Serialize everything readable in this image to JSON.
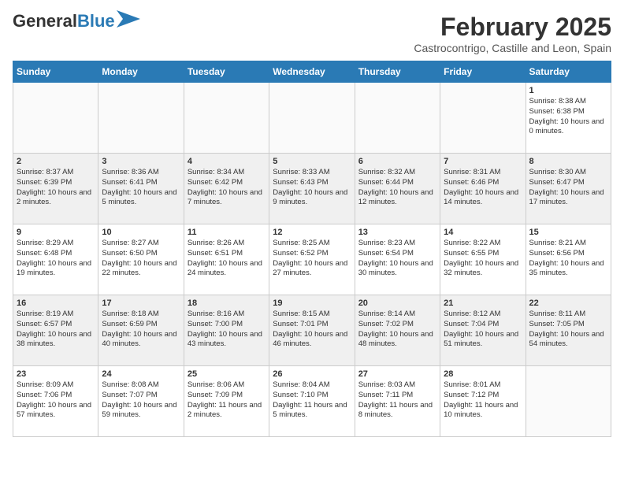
{
  "header": {
    "logo_general": "General",
    "logo_blue": "Blue",
    "title": "February 2025",
    "subtitle": "Castrocontrigo, Castille and Leon, Spain"
  },
  "days_of_week": [
    "Sunday",
    "Monday",
    "Tuesday",
    "Wednesday",
    "Thursday",
    "Friday",
    "Saturday"
  ],
  "weeks": [
    [
      {
        "day": "",
        "info": ""
      },
      {
        "day": "",
        "info": ""
      },
      {
        "day": "",
        "info": ""
      },
      {
        "day": "",
        "info": ""
      },
      {
        "day": "",
        "info": ""
      },
      {
        "day": "",
        "info": ""
      },
      {
        "day": "1",
        "info": "Sunrise: 8:38 AM\nSunset: 6:38 PM\nDaylight: 10 hours and 0 minutes."
      }
    ],
    [
      {
        "day": "2",
        "info": "Sunrise: 8:37 AM\nSunset: 6:39 PM\nDaylight: 10 hours and 2 minutes."
      },
      {
        "day": "3",
        "info": "Sunrise: 8:36 AM\nSunset: 6:41 PM\nDaylight: 10 hours and 5 minutes."
      },
      {
        "day": "4",
        "info": "Sunrise: 8:34 AM\nSunset: 6:42 PM\nDaylight: 10 hours and 7 minutes."
      },
      {
        "day": "5",
        "info": "Sunrise: 8:33 AM\nSunset: 6:43 PM\nDaylight: 10 hours and 9 minutes."
      },
      {
        "day": "6",
        "info": "Sunrise: 8:32 AM\nSunset: 6:44 PM\nDaylight: 10 hours and 12 minutes."
      },
      {
        "day": "7",
        "info": "Sunrise: 8:31 AM\nSunset: 6:46 PM\nDaylight: 10 hours and 14 minutes."
      },
      {
        "day": "8",
        "info": "Sunrise: 8:30 AM\nSunset: 6:47 PM\nDaylight: 10 hours and 17 minutes."
      }
    ],
    [
      {
        "day": "9",
        "info": "Sunrise: 8:29 AM\nSunset: 6:48 PM\nDaylight: 10 hours and 19 minutes."
      },
      {
        "day": "10",
        "info": "Sunrise: 8:27 AM\nSunset: 6:50 PM\nDaylight: 10 hours and 22 minutes."
      },
      {
        "day": "11",
        "info": "Sunrise: 8:26 AM\nSunset: 6:51 PM\nDaylight: 10 hours and 24 minutes."
      },
      {
        "day": "12",
        "info": "Sunrise: 8:25 AM\nSunset: 6:52 PM\nDaylight: 10 hours and 27 minutes."
      },
      {
        "day": "13",
        "info": "Sunrise: 8:23 AM\nSunset: 6:54 PM\nDaylight: 10 hours and 30 minutes."
      },
      {
        "day": "14",
        "info": "Sunrise: 8:22 AM\nSunset: 6:55 PM\nDaylight: 10 hours and 32 minutes."
      },
      {
        "day": "15",
        "info": "Sunrise: 8:21 AM\nSunset: 6:56 PM\nDaylight: 10 hours and 35 minutes."
      }
    ],
    [
      {
        "day": "16",
        "info": "Sunrise: 8:19 AM\nSunset: 6:57 PM\nDaylight: 10 hours and 38 minutes."
      },
      {
        "day": "17",
        "info": "Sunrise: 8:18 AM\nSunset: 6:59 PM\nDaylight: 10 hours and 40 minutes."
      },
      {
        "day": "18",
        "info": "Sunrise: 8:16 AM\nSunset: 7:00 PM\nDaylight: 10 hours and 43 minutes."
      },
      {
        "day": "19",
        "info": "Sunrise: 8:15 AM\nSunset: 7:01 PM\nDaylight: 10 hours and 46 minutes."
      },
      {
        "day": "20",
        "info": "Sunrise: 8:14 AM\nSunset: 7:02 PM\nDaylight: 10 hours and 48 minutes."
      },
      {
        "day": "21",
        "info": "Sunrise: 8:12 AM\nSunset: 7:04 PM\nDaylight: 10 hours and 51 minutes."
      },
      {
        "day": "22",
        "info": "Sunrise: 8:11 AM\nSunset: 7:05 PM\nDaylight: 10 hours and 54 minutes."
      }
    ],
    [
      {
        "day": "23",
        "info": "Sunrise: 8:09 AM\nSunset: 7:06 PM\nDaylight: 10 hours and 57 minutes."
      },
      {
        "day": "24",
        "info": "Sunrise: 8:08 AM\nSunset: 7:07 PM\nDaylight: 10 hours and 59 minutes."
      },
      {
        "day": "25",
        "info": "Sunrise: 8:06 AM\nSunset: 7:09 PM\nDaylight: 11 hours and 2 minutes."
      },
      {
        "day": "26",
        "info": "Sunrise: 8:04 AM\nSunset: 7:10 PM\nDaylight: 11 hours and 5 minutes."
      },
      {
        "day": "27",
        "info": "Sunrise: 8:03 AM\nSunset: 7:11 PM\nDaylight: 11 hours and 8 minutes."
      },
      {
        "day": "28",
        "info": "Sunrise: 8:01 AM\nSunset: 7:12 PM\nDaylight: 11 hours and 10 minutes."
      },
      {
        "day": "",
        "info": ""
      }
    ]
  ]
}
